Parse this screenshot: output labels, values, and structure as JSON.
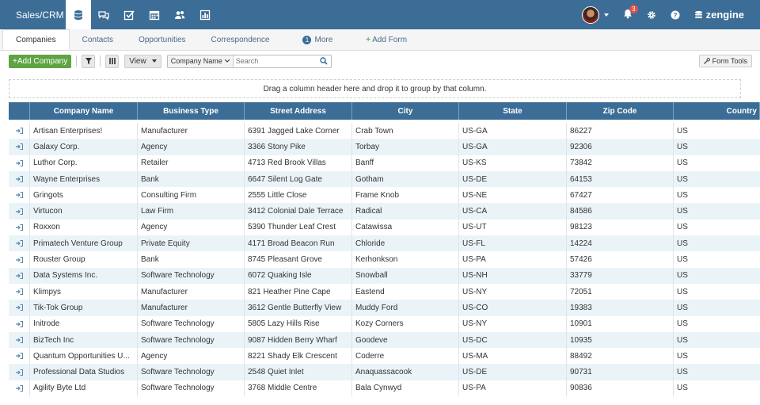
{
  "colors": {
    "topbar": "#3b6d96",
    "add_button": "#5fa443",
    "row_alt": "#eaf4f8",
    "badge": "#d9534f"
  },
  "app": {
    "switcher_label": "Sales/CRM",
    "brand": "zengine"
  },
  "nav_icons": [
    "database-icon",
    "chat-icon",
    "checkbox-icon",
    "calendar-icon",
    "users-icon",
    "chart-icon"
  ],
  "top_right": {
    "notifications_count": "3"
  },
  "tabs": [
    {
      "label": "Companies",
      "active": true
    },
    {
      "label": "Contacts"
    },
    {
      "label": "Opportunities"
    },
    {
      "label": "Correspondence"
    }
  ],
  "more_tab": {
    "count": "1",
    "label": "More"
  },
  "add_form_label": "Add Form",
  "toolbar": {
    "add_label": "+Add Company",
    "view_label": "View",
    "field_select": "Company Name",
    "search_placeholder": "Search",
    "form_tools_label": "Form Tools"
  },
  "group_hint": "Drag a column header here and drop it to group by that column.",
  "grid": {
    "columns": [
      "Company Name",
      "Business Type",
      "Street Address",
      "City",
      "State",
      "Zip Code",
      "Country"
    ],
    "rows": [
      [
        "Artisan Enterprises!",
        "Manufacturer",
        "6391 Jagged Lake Corner",
        "Crab Town",
        "US-GA",
        "86227",
        "US"
      ],
      [
        "Galaxy Corp.",
        "Agency",
        "3366 Stony Pike",
        "Torbay",
        "US-GA",
        "92306",
        "US"
      ],
      [
        "Luthor Corp.",
        "Retailer",
        "4713 Red Brook Villas",
        "Banff",
        "US-KS",
        "73842",
        "US"
      ],
      [
        "Wayne Enterprises",
        "Bank",
        "6647 Silent Log Gate",
        "Gotham",
        "US-DE",
        "64153",
        "US"
      ],
      [
        "Gringots",
        "Consulting Firm",
        "2555 Little Close",
        "Frame Knob",
        "US-NE",
        "67427",
        "US"
      ],
      [
        "Virtucon",
        "Law Firm",
        "3412 Colonial Dale Terrace",
        "Radical",
        "US-CA",
        "84586",
        "US"
      ],
      [
        "Roxxon",
        "Agency",
        "5390 Thunder Leaf Crest",
        "Catawissa",
        "US-UT",
        "98123",
        "US"
      ],
      [
        "Primatech Venture Group",
        "Private Equity",
        "4171 Broad Beacon Run",
        "Chloride",
        "US-FL",
        "14224",
        "US"
      ],
      [
        "Rouster Group",
        "Bank",
        "8745 Pleasant Grove",
        "Kerhonkson",
        "US-PA",
        "57426",
        "US"
      ],
      [
        "Data Systems Inc.",
        "Software Technology",
        "6072 Quaking Isle",
        "Snowball",
        "US-NH",
        "33779",
        "US"
      ],
      [
        "Klimpys",
        "Manufacturer",
        "821 Heather Pine Cape",
        "Eastend",
        "US-NY",
        "72051",
        "US"
      ],
      [
        "Tik-Tok Group",
        "Manufacturer",
        "3612 Gentle Butterfly View",
        "Muddy Ford",
        "US-CO",
        "19383",
        "US"
      ],
      [
        "Initrode",
        "Software Technology",
        "5805 Lazy Hills Rise",
        "Kozy Corners",
        "US-NY",
        "10901",
        "US"
      ],
      [
        "BizTech Inc",
        "Software Technology",
        "9087 Hidden Berry Wharf",
        "Goodeve",
        "US-DC",
        "10935",
        "US"
      ],
      [
        "Quantum Opportunities U...",
        "Agency",
        "8221 Shady Elk Crescent",
        "Coderre",
        "US-MA",
        "88492",
        "US"
      ],
      [
        "Professional Data Studios",
        "Software Technology",
        "2548 Quiet Inlet",
        "Anaquassacook",
        "US-DE",
        "90731",
        "US"
      ],
      [
        "Agility Byte Ltd",
        "Software Technology",
        "3768 Middle Centre",
        "Bala Cynwyd",
        "US-PA",
        "90836",
        "US"
      ]
    ]
  }
}
